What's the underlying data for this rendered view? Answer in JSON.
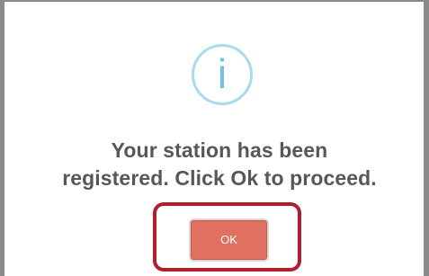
{
  "dialog": {
    "icon": "info-icon",
    "icon_glyph": "i",
    "message_line1": "Your station has been",
    "message_line2": "registered. Click Ok to proceed.",
    "ok_label": "OK"
  },
  "colors": {
    "icon_ring": "#a7dcef",
    "icon_glyph": "#6cc3e6",
    "message_text": "#575757",
    "button_bg": "#e0705f",
    "button_text": "#ffffff",
    "highlight_border": "#b21e2b",
    "frame_border": "#8a8a8a"
  }
}
